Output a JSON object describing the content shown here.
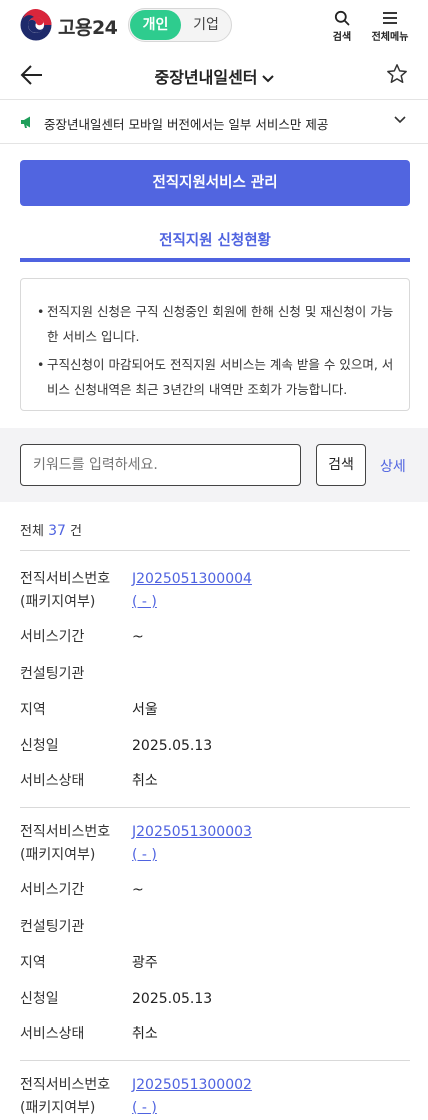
{
  "header": {
    "brand": "고용24",
    "segment": {
      "active": "개인",
      "inactive": "기업"
    },
    "search_label": "검색",
    "menu_label": "전체메뉴"
  },
  "titlebar": {
    "title": "중장년내일센터"
  },
  "notice": {
    "text": "중장년내일센터 모바일 버전에서는 일부 서비스만 제공"
  },
  "main_button": "전직지원서비스 관리",
  "subtab": "전직지원 신청현황",
  "info": {
    "items": [
      "전직지원 신청은 구직 신청중인 회원에 한해 신청 및 재신청이 가능한 서비스 입니다.",
      "구직신청이 마감되어도 전직지원 서비스는 계속 받을 수 있으며, 서비스 신청내역은 최근 3년간의 내역만 조회가 가능합니다."
    ]
  },
  "search": {
    "placeholder": "키워드를 입력하세요.",
    "button": "검색",
    "detail": "상세"
  },
  "count": {
    "prefix": "전체",
    "num": "37",
    "suffix": "건"
  },
  "labels": {
    "service_no": "전직서비스번호",
    "package": "(패키지여부)",
    "period": "서비스기간",
    "org": "컨설팅기관",
    "region": "지역",
    "date": "신청일",
    "status": "서비스상태"
  },
  "records": [
    {
      "service_no": "J2025051300004",
      "package": "( - )",
      "period": "~",
      "org": "",
      "region": "서울",
      "date": "2025.05.13",
      "status": "취소"
    },
    {
      "service_no": "J2025051300003",
      "package": "( - )",
      "period": "~",
      "org": "",
      "region": "광주",
      "date": "2025.05.13",
      "status": "취소"
    },
    {
      "service_no": "J2025051300002",
      "package": "( - )"
    }
  ],
  "colors": {
    "accent": "#5165e0",
    "toggle": "#2ecc8e"
  }
}
